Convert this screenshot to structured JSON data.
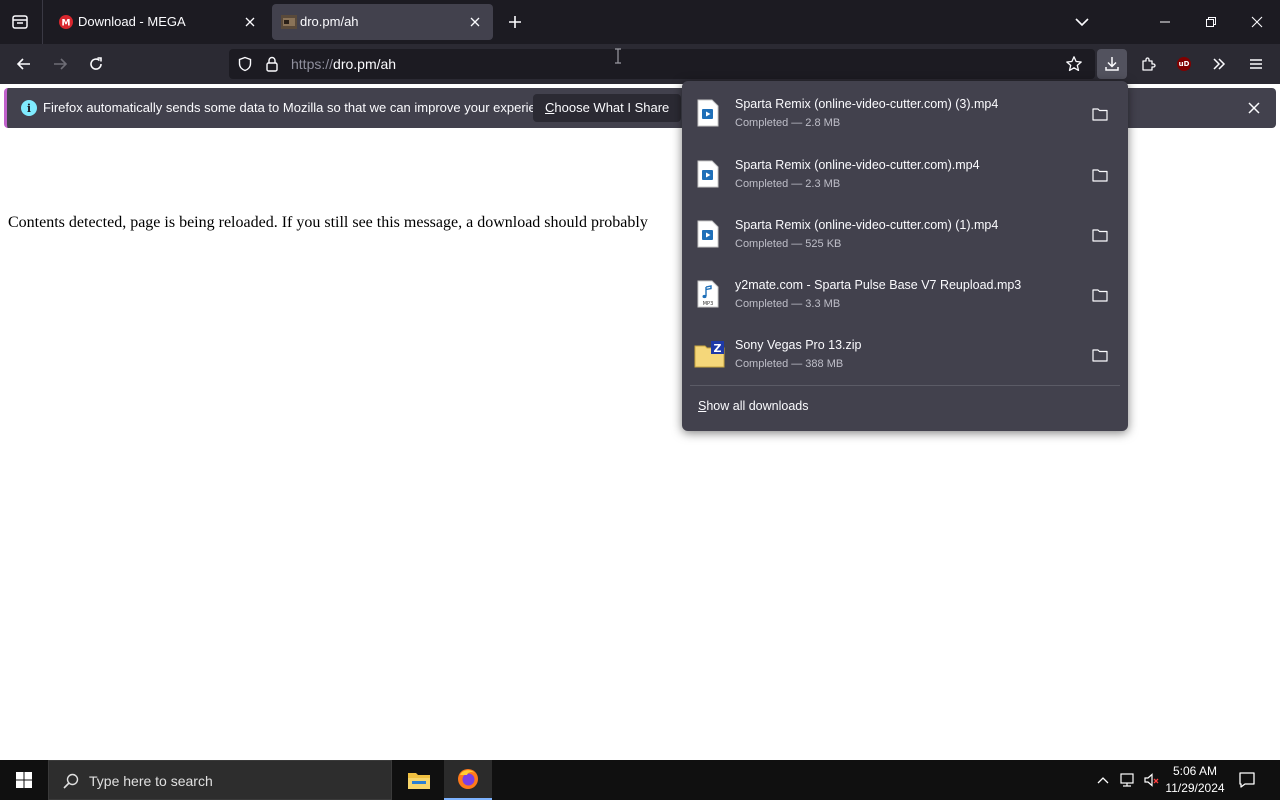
{
  "tabs": [
    {
      "title": "Download - MEGA",
      "favicon": "mega-icon",
      "active": false
    },
    {
      "title": "dro.pm/ah",
      "favicon": "site-icon",
      "active": true
    }
  ],
  "navbar": {
    "url_scheme": "https://",
    "url_host": "dro.pm/ah"
  },
  "notification": {
    "message": "Firefox automatically sends some data to Mozilla so that we can improve your experience.",
    "button_first_letter": "C",
    "button_rest": "hoose What I Share"
  },
  "page": {
    "body_text": "Contents detected, page is being reloaded. If you still see this message, a download should probably"
  },
  "downloads": {
    "items": [
      {
        "name": "Sparta Remix (online-video-cutter.com) (3).mp4",
        "status": "Completed — 2.8 MB",
        "type": "video-file-icon"
      },
      {
        "name": "Sparta Remix (online-video-cutter.com).mp4",
        "status": "Completed — 2.3 MB",
        "type": "video-file-icon"
      },
      {
        "name": "Sparta Remix (online-video-cutter.com) (1).mp4",
        "status": "Completed — 525 KB",
        "type": "video-file-icon"
      },
      {
        "name": "y2mate.com - Sparta Pulse Base V7 Reupload.mp3",
        "status": "Completed — 3.3 MB",
        "type": "audio-file-icon"
      },
      {
        "name": "Sony Vegas Pro 13.zip",
        "status": "Completed — 388 MB",
        "type": "zip-file-icon"
      }
    ],
    "show_all_first_letter": "S",
    "show_all_rest": "how all downloads"
  },
  "taskbar": {
    "search_placeholder": "Type here to search",
    "time": "5:06 AM",
    "date": "11/29/2024"
  },
  "colors": {
    "tabstrip_bg": "#1c1b22",
    "navbar_bg": "#2b2a33",
    "panel_bg": "#42414d",
    "accent": "#c061cb"
  }
}
